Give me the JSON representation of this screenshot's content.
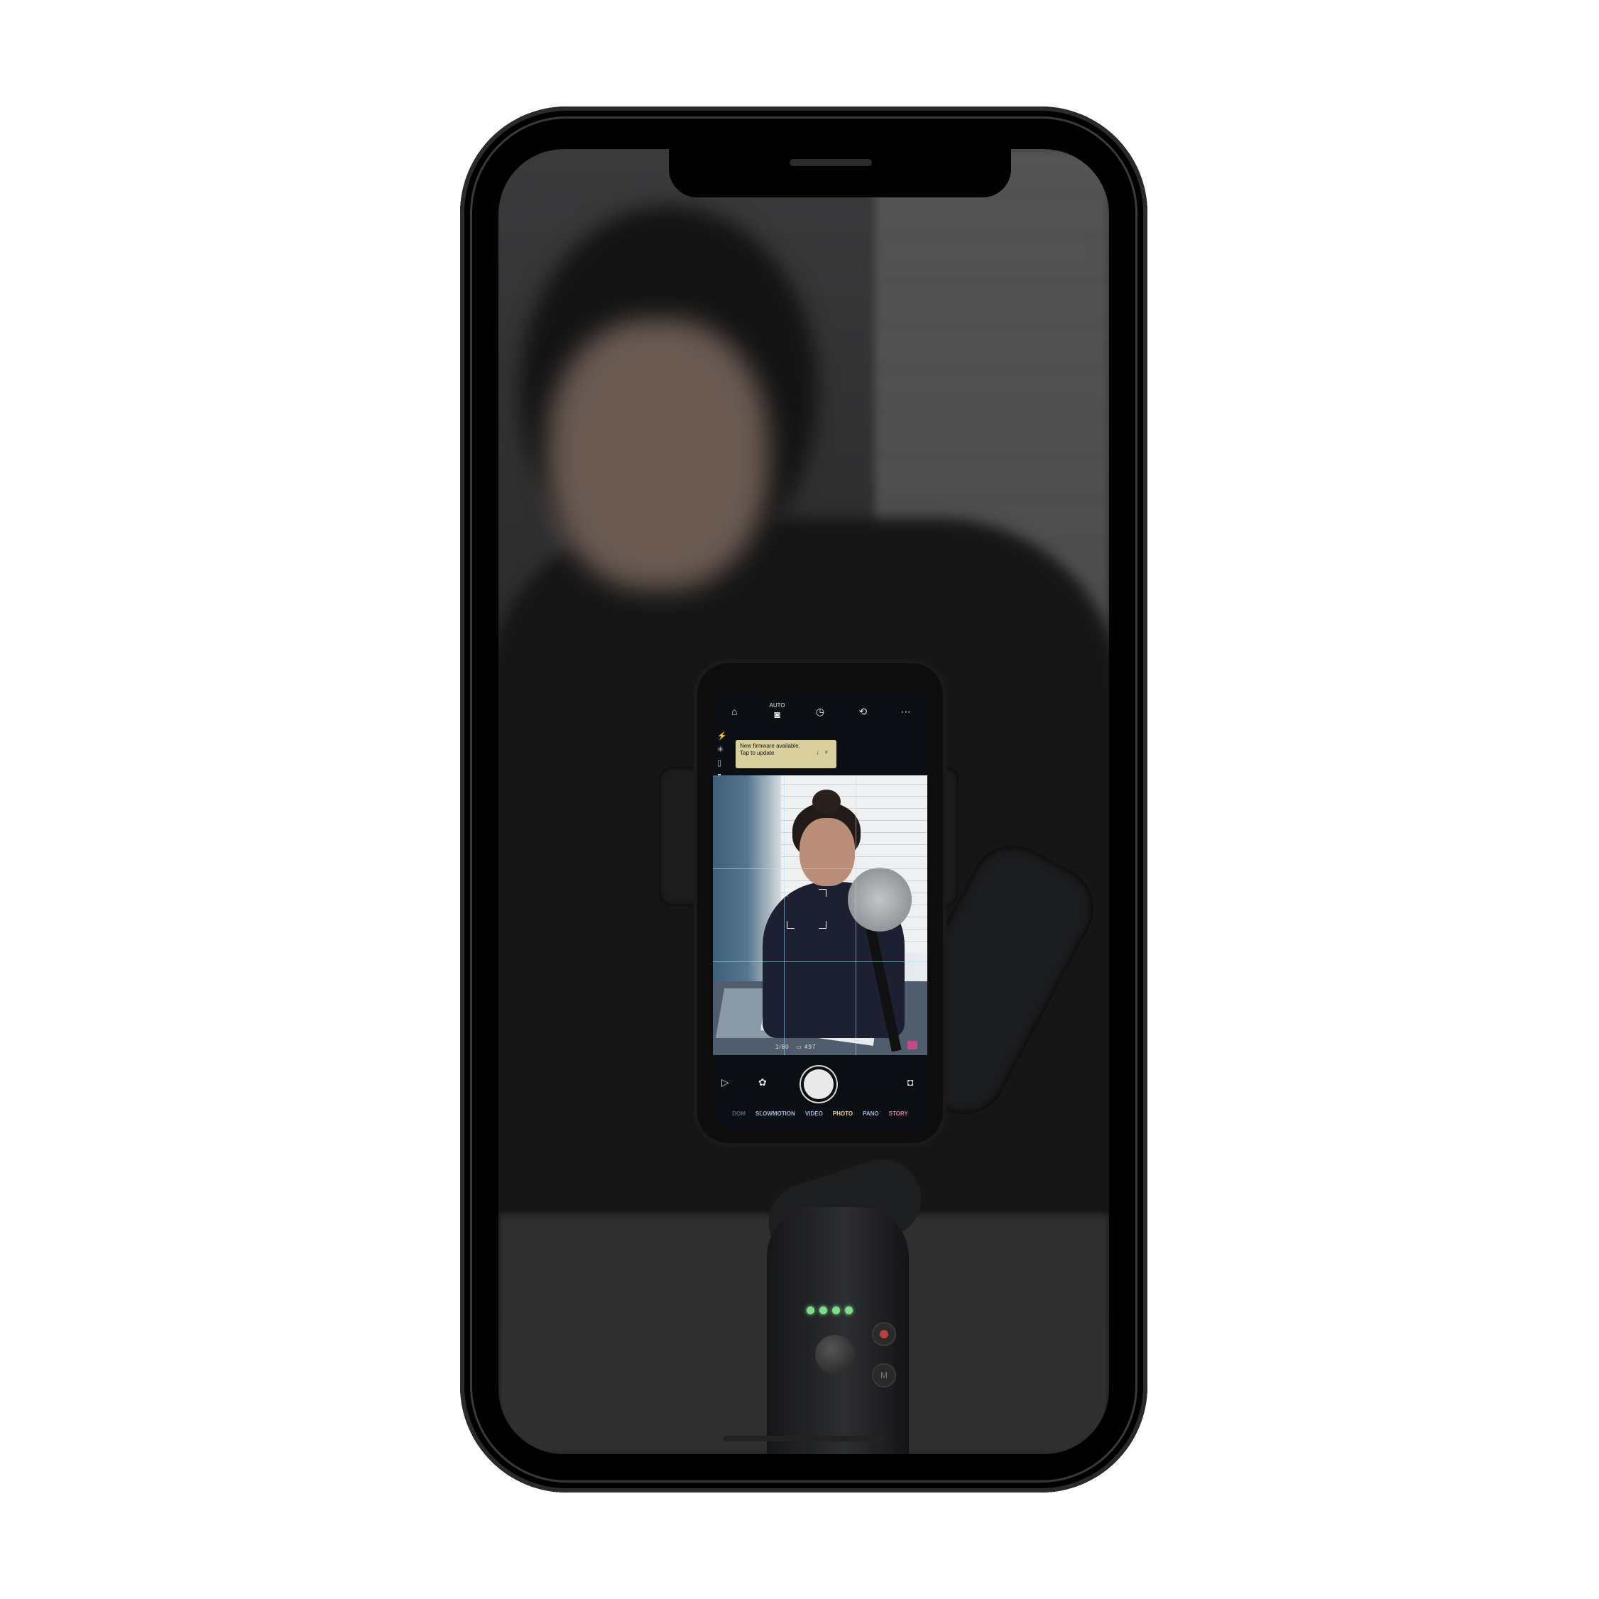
{
  "device": {
    "model_icon": "smartphone-frame"
  },
  "camera_app": {
    "top_bar": {
      "home": "home-icon",
      "auto_label": "AUTO",
      "camera_mode": "camera-icon",
      "timer": "timer-icon",
      "flip": "flip-camera-icon",
      "more": "more-icon"
    },
    "side_icons": [
      "flash-icon",
      "brightness-icon",
      "battery-icon",
      "phone-icon"
    ],
    "banner": {
      "line1": "New firmware available.",
      "line2": "Tap to update",
      "download": "download-icon",
      "close": "×"
    },
    "preview_stats": {
      "shutter": "1/60",
      "remaining": "497"
    },
    "bottom_controls": {
      "gallery": "play-icon",
      "effects": "effects-icon",
      "switch_camera": "switch-camera-icon"
    },
    "modes": [
      {
        "label": "DOM",
        "state": "faded"
      },
      {
        "label": "SLOWMOTION",
        "state": "normal"
      },
      {
        "label": "VIDEO",
        "state": "normal"
      },
      {
        "label": "PHOTO",
        "state": "active"
      },
      {
        "label": "PANO",
        "state": "normal"
      },
      {
        "label": "STORY",
        "state": "story"
      }
    ]
  },
  "gimbal": {
    "led_count": 4,
    "m_button_label": "M"
  },
  "colors": {
    "active_mode": "#f0d58a",
    "story_mode": "#e07a9a",
    "banner_bg": "#d8cf9c",
    "led": "#7fdc8a"
  }
}
